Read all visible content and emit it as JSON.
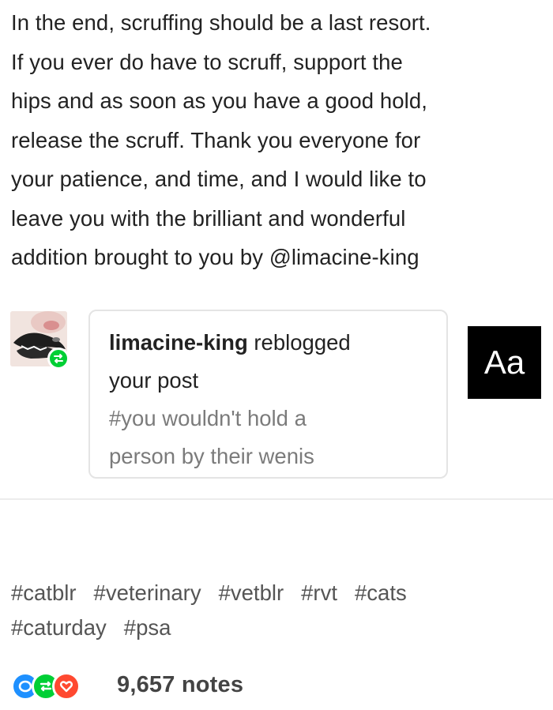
{
  "post": {
    "body_lines": [
      "In the end, scruffing should be a last resort.",
      "If you ever do have to scruff, support the",
      "hips and as soon as you have a good hold,",
      "release the scruff. Thank you everyone for",
      "your patience, and time, and I would like to",
      "leave you with the brilliant and wonderful",
      "addition brought to you by @limacine-king"
    ]
  },
  "notification": {
    "username": "limacine-king",
    "action_part1": " reblogged",
    "action_part2": "your post",
    "tag_line1": "#you wouldn't hold a",
    "tag_line2": "person by their wenis",
    "aa_label": "Aa",
    "badge_icon": "reblog-icon"
  },
  "tags": [
    "#catblr",
    "#veterinary",
    "#vetblr",
    "#rvt",
    "#cats",
    "#caturday",
    "#psa"
  ],
  "notes": {
    "count": "9,657 notes",
    "icons": [
      {
        "name": "comment-icon",
        "color": "#1e90ff"
      },
      {
        "name": "reblog-icon",
        "color": "#00cf35"
      },
      {
        "name": "like-icon",
        "color": "#ff4930"
      }
    ]
  }
}
